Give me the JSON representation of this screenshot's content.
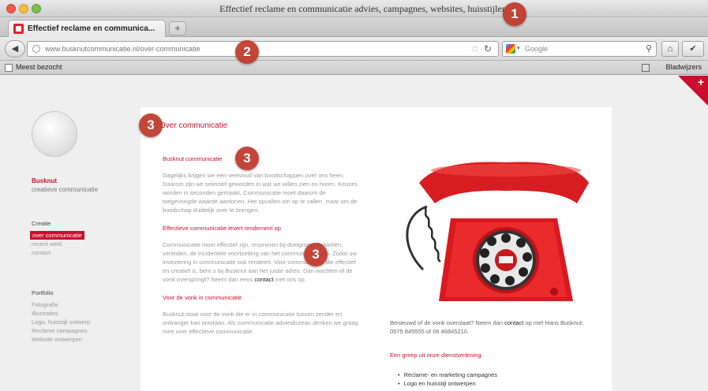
{
  "window": {
    "title": "Effectief reclame en communicatie advies, campagnes, websites, huisstijlen"
  },
  "tab": {
    "label": "Effectief reclame en communica...",
    "new_tab_symbol": "+"
  },
  "address_bar": {
    "url": "www.busknutcommunicatie.nl/over-communicatie"
  },
  "search_bar": {
    "placeholder": "Google"
  },
  "bookmarks": {
    "left_item": "Meest bezocht",
    "right_item": "Bladwijzers"
  },
  "sidebar": {
    "brand_name": "Busknut",
    "brand_tagline": "creatieve communicatie",
    "groups": [
      {
        "title": "Creatie",
        "items": [
          "over communicatie",
          "recent werk",
          "contact"
        ]
      },
      {
        "title": "Portfolio",
        "items": [
          "Fotografie",
          "Illustraties",
          "Logo, huisstijl ontwerp",
          "Reclame campagnes",
          "Website ontwerpen"
        ]
      }
    ]
  },
  "content": {
    "title": "Over communicatie",
    "sections": [
      {
        "heading": "Busknut communicatie",
        "body": "Dagelijks krijgen we een veelvoud van boodschappen over ons heen. Daarom zijn we selectief geworden in wat we willen zien en horen. Keuzes worden in seconden gemaakt. Communicatie moet daarom de toegevoegde waarde aantonen. Het opvallen om op te vallen, maar om de boodschap duidelijk over te brengen.",
        "link": ""
      },
      {
        "heading": "Effectieve communicatie levert rendement op",
        "body": "Communicatie moet effectief zijn, resoneren bij doelgroep. Prikkelen, verleiden, de incidentele voortzetting van het communicatieplan. Zodat uw investering in communicatie ook rendeert. Voor communicatie die effectief en creatief is, bent u bij Busknut aan het juiste adres. Dan wachten of de vonk overspringt? Neem dan eens",
        "link": "contact",
        "tail": " met ons op."
      },
      {
        "heading": "Voor de vonk in communicatie",
        "body": "Busknut staat voor de vonk die er in communicatie tussen zender en ontvanger kan ontstaan. Als communicatie adviesbureau denken we graag mee over effectieve communicatie.",
        "link": ""
      }
    ]
  },
  "right_panel": {
    "intro": "Benieuwd of de vonk overslaat? Neem dan",
    "contact_link": "contact",
    "intro_tail": "op met Hans Busknut: 0575 845555 of 06 46845210.",
    "services_title": "Een greep uit onze dienstverlening:",
    "services": [
      "Reclame- en marketing campagnes",
      "Logo en huisstijl ontwerpen"
    ]
  },
  "badges": [
    "1",
    "2",
    "3",
    "3",
    "3"
  ],
  "colors": {
    "brand_red": "#c8102e",
    "badge_red": "#c0392b",
    "page_bg": "#efefef"
  }
}
